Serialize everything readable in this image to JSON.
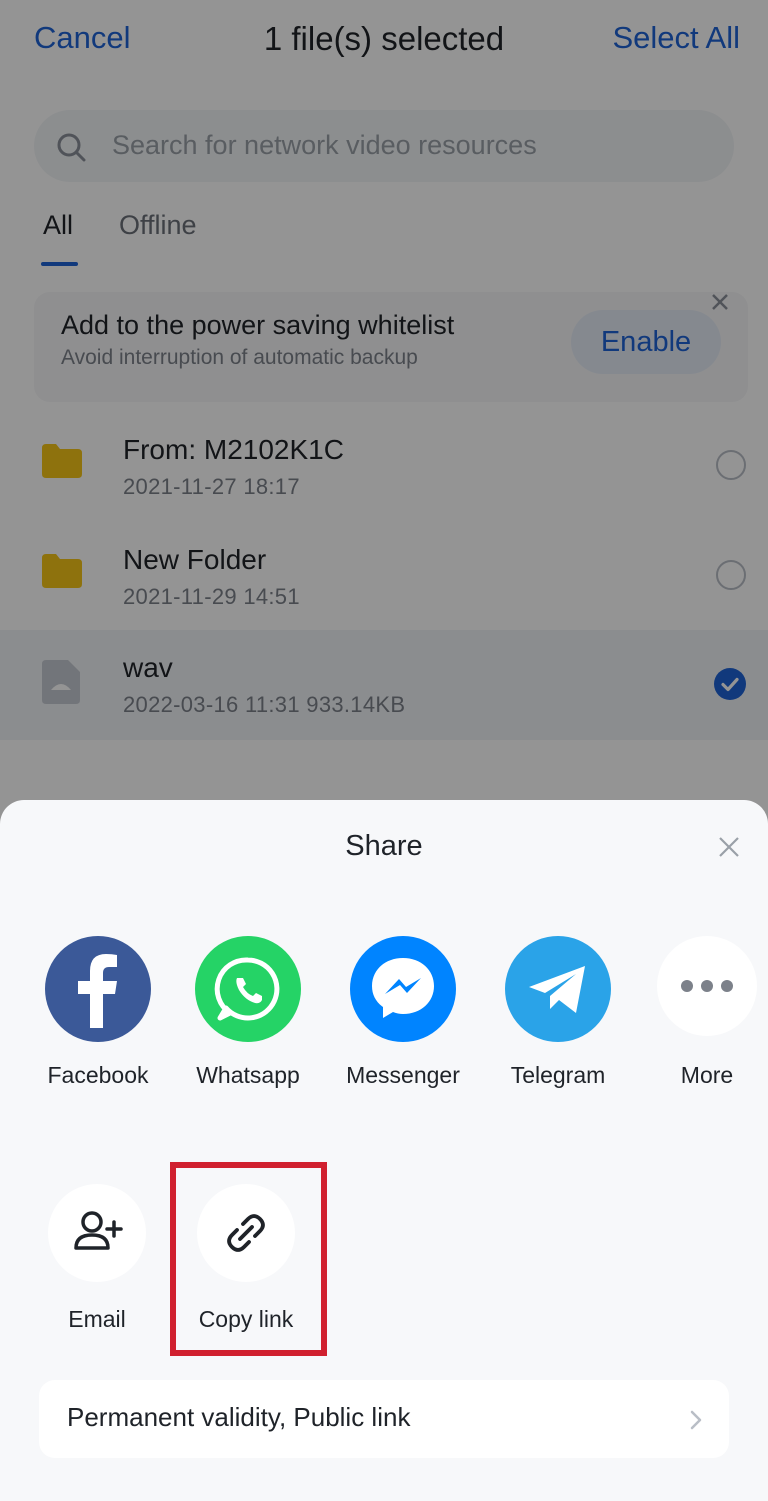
{
  "topbar": {
    "cancel": "Cancel",
    "title": "1 file(s) selected",
    "select_all": "Select All"
  },
  "search": {
    "placeholder": "Search for network video resources"
  },
  "tabs": [
    {
      "label": "All",
      "active": true
    },
    {
      "label": "Offline",
      "active": false
    }
  ],
  "banner": {
    "title": "Add to the power saving whitelist",
    "subtitle": "Avoid interruption of automatic backup",
    "button": "Enable"
  },
  "files": [
    {
      "name": "From: M2102K1C",
      "meta": "2021-11-27  18:17",
      "type": "folder",
      "selected": false
    },
    {
      "name": "New Folder",
      "meta": "2021-11-29  14:51",
      "type": "folder",
      "selected": false
    },
    {
      "name": "wav",
      "meta": "2022-03-16  11:31  933.14KB",
      "type": "file",
      "selected": true
    }
  ],
  "share": {
    "title": "Share",
    "apps": [
      {
        "label": "Facebook",
        "icon": "facebook-icon",
        "color": "#3b5998"
      },
      {
        "label": "Whatsapp",
        "icon": "whatsapp-icon",
        "color": "#25d366"
      },
      {
        "label": "Messenger",
        "icon": "messenger-icon",
        "color": "#0084ff"
      },
      {
        "label": "Telegram",
        "icon": "telegram-icon",
        "color": "#2aa3e8"
      },
      {
        "label": "More",
        "icon": "more-icon",
        "color": "#ffffff"
      }
    ],
    "options": [
      {
        "label": "Email",
        "icon": "add-user-icon"
      },
      {
        "label": "Copy link",
        "icon": "link-icon"
      }
    ],
    "permission": "Permanent validity, Public link"
  },
  "colors": {
    "accent": "#1e63d6",
    "highlight": "#d0202f",
    "folder": "#f5c518"
  }
}
